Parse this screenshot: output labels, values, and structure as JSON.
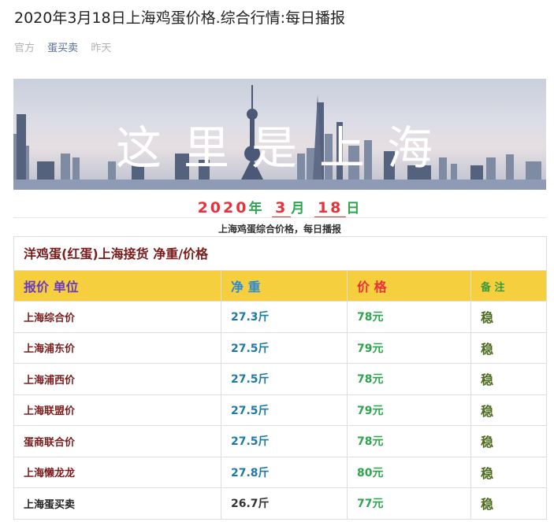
{
  "article": {
    "title": "2020年3月18日上海鸡蛋价格.综合行情:每日播报",
    "meta_source": "官方",
    "meta_author": "蛋买卖",
    "meta_time": "昨天"
  },
  "banner": {
    "calligraphy_text": "这里是上海",
    "colors": {
      "sky": "#d7d9e3",
      "skyline": "#5b6b86",
      "water": "#9aa6bd"
    }
  },
  "date_line": {
    "year": "2020",
    "year_unit": "年",
    "month": "3",
    "month_unit": "月",
    "day": "18",
    "day_unit": "日",
    "subtitle": "上海鸡蛋综合价格，每日播报"
  },
  "price_table": {
    "caption": "洋鸡蛋(红蛋)上海接货 净重/价格",
    "headers": [
      "报价 单位",
      "净 重",
      "价 格",
      "备 注"
    ],
    "rows": [
      {
        "name": "上海综合价",
        "weight": "27.3斤",
        "price": "78元",
        "note": "稳"
      },
      {
        "name": "上海浦东价",
        "weight": "27.5斤",
        "price": "79元",
        "note": "稳"
      },
      {
        "name": "上海浦西价",
        "weight": "27.5斤",
        "price": "78元",
        "note": "稳"
      },
      {
        "name": "上海联盟价",
        "weight": "27.5斤",
        "price": "79元",
        "note": "稳"
      },
      {
        "name": "蛋商联合价",
        "weight": "27.5斤",
        "price": "78元",
        "note": "稳"
      },
      {
        "name": "上海懒龙龙",
        "weight": "27.8斤",
        "price": "80元",
        "note": "稳"
      },
      {
        "name": "上海蛋买卖",
        "weight": "26.7斤",
        "price": "77元",
        "note": "稳"
      }
    ]
  },
  "colors": {
    "header_bg": "#f6cf3f",
    "red": "#e8313a",
    "green": "#2da44e",
    "blue": "#1d7aa8",
    "maroon": "#7a1c1c"
  }
}
